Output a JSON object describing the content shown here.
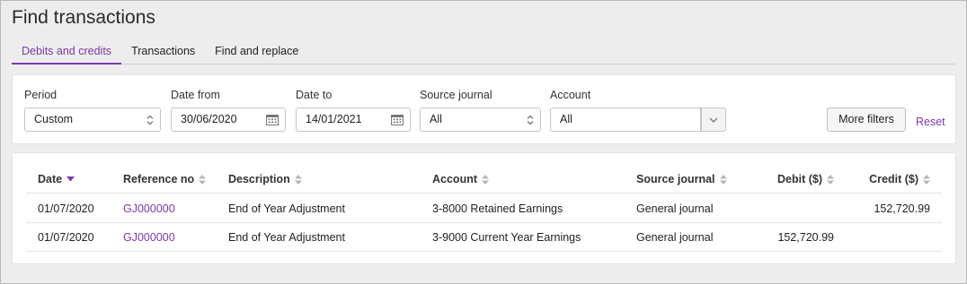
{
  "page": {
    "title": "Find transactions"
  },
  "tabs": [
    {
      "label": "Debits and credits",
      "active": true
    },
    {
      "label": "Transactions",
      "active": false
    },
    {
      "label": "Find and replace",
      "active": false
    }
  ],
  "filters": {
    "period": {
      "label": "Period",
      "value": "Custom"
    },
    "date_from": {
      "label": "Date from",
      "value": "30/06/2020"
    },
    "date_to": {
      "label": "Date to",
      "value": "14/01/2021"
    },
    "source_journal": {
      "label": "Source journal",
      "value": "All"
    },
    "account": {
      "label": "Account",
      "value": "All"
    },
    "more_filters_label": "More filters",
    "reset_label": "Reset"
  },
  "table": {
    "columns": {
      "date": "Date",
      "reference": "Reference no",
      "description": "Description",
      "account": "Account",
      "source": "Source journal",
      "debit": "Debit ($)",
      "credit": "Credit ($)"
    },
    "rows": [
      {
        "date": "01/07/2020",
        "reference": "GJ000000",
        "description": "End of Year Adjustment",
        "account": "3-8000 Retained Earnings",
        "source": "General journal",
        "debit": "",
        "credit": "152,720.99"
      },
      {
        "date": "01/07/2020",
        "reference": "GJ000000",
        "description": "End of Year Adjustment",
        "account": "3-9000 Current Year Earnings",
        "source": "General journal",
        "debit": "152,720.99",
        "credit": ""
      }
    ]
  },
  "colors": {
    "accent": "#7b3aa6",
    "background": "#ededed"
  }
}
